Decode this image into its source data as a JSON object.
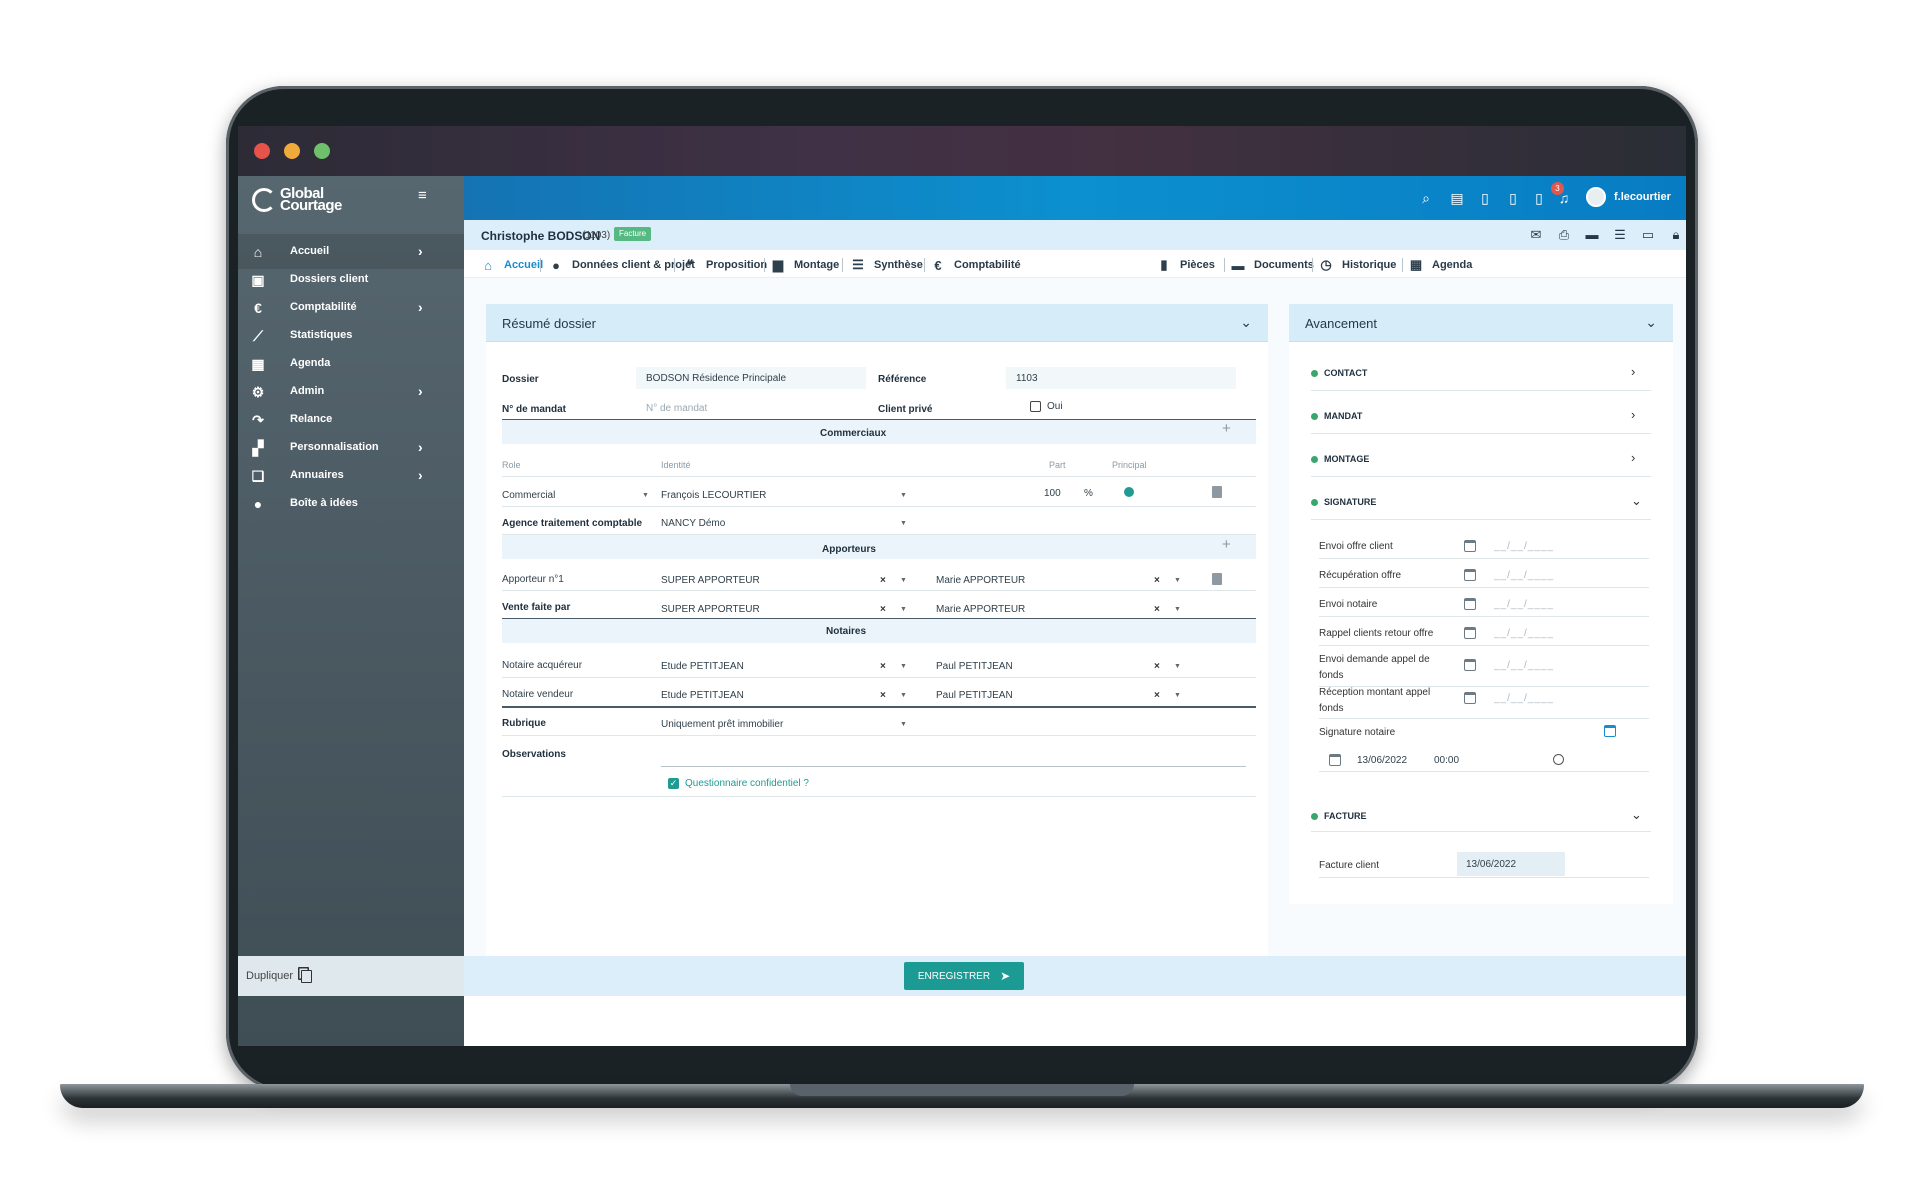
{
  "brand": {
    "name_line1": "Global",
    "name_line2": "Courtage"
  },
  "sidebar": {
    "items": [
      {
        "label": "Accueil",
        "icon": "home-icon",
        "glyph": "⌂",
        "chevron": true
      },
      {
        "label": "Dossiers client",
        "icon": "folder-person-icon",
        "glyph": "▣",
        "chevron": false
      },
      {
        "label": "Comptabilité",
        "icon": "euro-icon",
        "glyph": "€",
        "chevron": true
      },
      {
        "label": "Statistiques",
        "icon": "chart-icon",
        "glyph": "⟋",
        "chevron": false
      },
      {
        "label": "Agenda",
        "icon": "calendar-icon",
        "glyph": "▦",
        "chevron": false
      },
      {
        "label": "Admin",
        "icon": "gear-icon",
        "glyph": "⚙",
        "chevron": true
      },
      {
        "label": "Relance",
        "icon": "redo-icon",
        "glyph": "↷",
        "chevron": false
      },
      {
        "label": "Personnalisation",
        "icon": "dashboard-icon",
        "glyph": "▞",
        "chevron": true
      },
      {
        "label": "Annuaires",
        "icon": "book-icon",
        "glyph": "❏",
        "chevron": true
      },
      {
        "label": "Boîte à idées",
        "icon": "lightbulb-icon",
        "glyph": "●",
        "chevron": false
      }
    ],
    "duplicate_label": "Dupliquer"
  },
  "topbar": {
    "notification_count": "3",
    "username": "f.lecourtier"
  },
  "client": {
    "name": "Christophe BODSON",
    "number": "(1103)",
    "status": "Facture"
  },
  "nav": {
    "tabs": [
      {
        "label": "Accueil",
        "active": true
      },
      {
        "label": "Données client & projet",
        "active": false
      },
      {
        "label": "Proposition",
        "active": false
      },
      {
        "label": "Montage",
        "active": false
      },
      {
        "label": "Synthèse",
        "active": false
      },
      {
        "label": "Comptabilité",
        "active": false
      }
    ],
    "right_tabs": [
      {
        "label": "Pièces"
      },
      {
        "label": "Documents"
      },
      {
        "label": "Historique"
      },
      {
        "label": "Agenda"
      }
    ]
  },
  "summary": {
    "title": "Résumé dossier",
    "dossier_label": "Dossier",
    "dossier_value": "BODSON Résidence Principale",
    "reference_label": "Référence",
    "reference_value": "1103",
    "mandat_label": "N° de mandat",
    "mandat_placeholder": "N° de mandat",
    "client_prive_label": "Client privé",
    "client_prive_option": "Oui",
    "commerciaux": {
      "title": "Commerciaux",
      "col_role": "Role",
      "col_identite": "Identité",
      "col_part": "Part",
      "col_principal": "Principal",
      "role": "Commercial",
      "identite": "François LECOURTIER",
      "part": "100",
      "unit": "%"
    },
    "agence_label": "Agence traitement comptable",
    "agence_value": "NANCY Démo",
    "apporteurs": {
      "title": "Apporteurs",
      "row1_label": "Apporteur n°1",
      "row1_value1": "SUPER APPORTEUR",
      "row1_value2": "Marie APPORTEUR",
      "row2_label": "Vente faite par",
      "row2_value1": "SUPER APPORTEUR",
      "row2_value2": "Marie APPORTEUR"
    },
    "notaires": {
      "title": "Notaires",
      "row1_label": "Notaire acquéreur",
      "row1_value1": "Etude PETITJEAN",
      "row1_value2": "Paul PETITJEAN",
      "row2_label": "Notaire vendeur",
      "row2_value1": "Etude PETITJEAN",
      "row2_value2": "Paul PETITJEAN"
    },
    "rubrique_label": "Rubrique",
    "rubrique_value": "Uniquement prêt immobilier",
    "observations_label": "Observations",
    "questionnaire_label": "Questionnaire confidentiel ?"
  },
  "progress": {
    "title": "Avancement",
    "steps": [
      "CONTACT",
      "MANDAT",
      "MONTAGE",
      "SIGNATURE",
      "FACTURE"
    ],
    "signature_rows": [
      {
        "label": "Envoi offre client",
        "date": "__/__/____"
      },
      {
        "label": "Récupération offre",
        "date": "__/__/____"
      },
      {
        "label": "Envoi notaire",
        "date": "__/__/____"
      },
      {
        "label": "Rappel clients retour offre",
        "date": "__/__/____"
      },
      {
        "label": "Envoi demande appel de fonds",
        "date": "__/__/____"
      },
      {
        "label": "Réception montant appel fonds",
        "date": "__/__/____"
      }
    ],
    "signature_notaire_label": "Signature notaire",
    "signature_notaire_date": "13/06/2022",
    "signature_notaire_time": "00:00",
    "facture_client_label": "Facture client",
    "facture_client_date": "13/06/2022"
  },
  "footer": {
    "save_label": "ENREGISTRER"
  },
  "colors": {
    "accent": "#1b9b93",
    "topbar": "#0c90cf",
    "sidebar": "#4b5b63"
  }
}
